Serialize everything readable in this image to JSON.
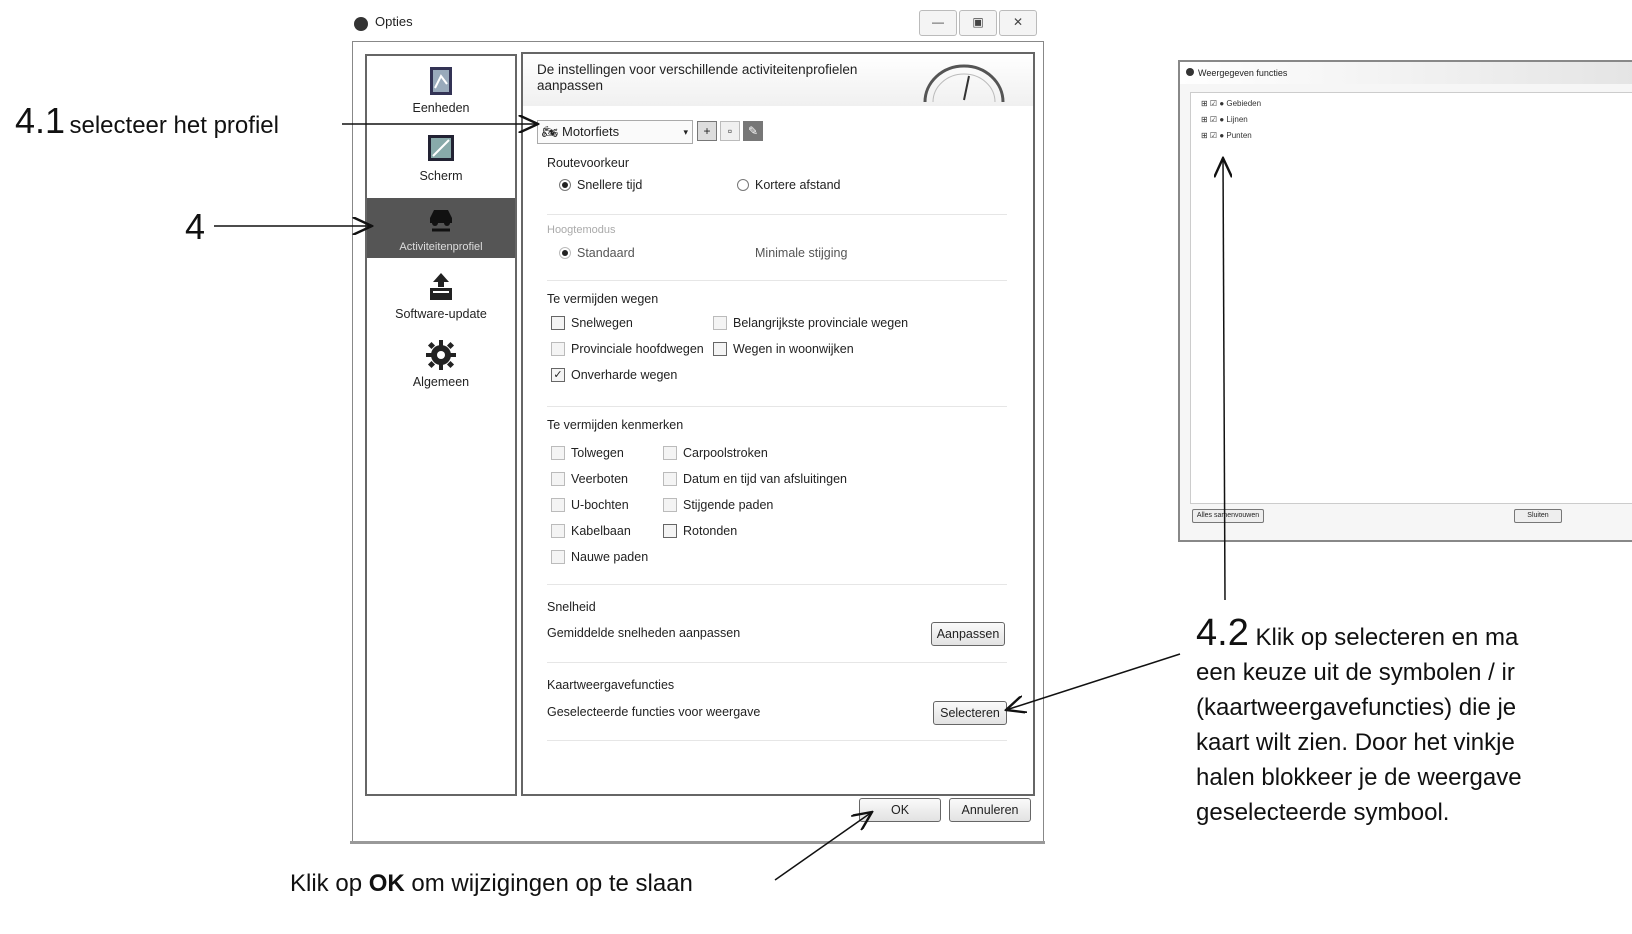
{
  "window": {
    "title": "Opties",
    "buttons": [
      "—",
      "▣",
      "✕"
    ]
  },
  "sidebar": {
    "items": [
      {
        "label": "Eenheden",
        "icon": "ruler-map-icon"
      },
      {
        "label": "Scherm",
        "icon": "screen-icon"
      },
      {
        "label": "Activiteitenprofiel",
        "icon": "car-wrench-icon",
        "active": true
      },
      {
        "label": "Software-update",
        "icon": "box-upload-icon"
      },
      {
        "label": "Algemeen",
        "icon": "gear-icon"
      }
    ]
  },
  "panel": {
    "header": "De instellingen voor verschillende activiteitenprofielen aanpassen",
    "profile_select": "Motorfiets",
    "route": {
      "title": "Routevoorkeur",
      "options": [
        "Snellere tijd",
        "Kortere afstand"
      ],
      "selected": "Snellere tijd"
    },
    "height": {
      "title": "Hoogtemodus",
      "options": [
        "Standaard",
        "Minimale stijging"
      ],
      "selected": "Standaard"
    },
    "avoid_roads": {
      "title": "Te vermijden wegen",
      "items": [
        {
          "label": "Snelwegen",
          "checked": false
        },
        {
          "label": "Belangrijkste provinciale wegen",
          "checked": false
        },
        {
          "label": "Provinciale hoofdwegen",
          "checked": false
        },
        {
          "label": "Wegen in woonwijken",
          "checked": false
        },
        {
          "label": "Onverharde wegen",
          "checked": true
        }
      ]
    },
    "avoid_features": {
      "title": "Te vermijden kenmerken",
      "items": [
        {
          "label": "Tolwegen",
          "checked": false
        },
        {
          "label": "Carpoolstroken",
          "checked": false
        },
        {
          "label": "Veerboten",
          "checked": false
        },
        {
          "label": "Datum en tijd van afsluitingen",
          "checked": false
        },
        {
          "label": "U-bochten",
          "checked": false
        },
        {
          "label": "Stijgende paden",
          "checked": false
        },
        {
          "label": "Kabelbaan",
          "checked": false
        },
        {
          "label": "Rotonden",
          "checked": false
        },
        {
          "label": "Nauwe paden",
          "checked": false
        }
      ]
    },
    "speed": {
      "title": "Snelheid",
      "label": "Gemiddelde snelheden aanpassen",
      "button": "Aanpassen"
    },
    "map_features": {
      "title": "Kaartweergavefuncties",
      "label": "Geselecteerde functies voor weergave",
      "button": "Selecteren"
    }
  },
  "footer": {
    "ok": "OK",
    "cancel": "Annuleren"
  },
  "side_window": {
    "title": "Weergegeven functies",
    "items": [
      "Gebieden",
      "Lijnen",
      "Punten"
    ],
    "left_button": "Alles samenvouwen",
    "right_button": "Sluiten"
  },
  "annotations": {
    "a41_num": "4.1",
    "a41_text": "selecteer het profiel",
    "a4": "4",
    "a42_num": "4.2",
    "a42_lines": [
      "Klik op selecteren en ma",
      "een keuze uit de symbolen / ir",
      "(kaartweergavefuncties) die je",
      "kaart wilt zien. Door het vinkje",
      "halen blokkeer je de weergave",
      "geselecteerde symbool."
    ],
    "ok_pre": "Klik op",
    "ok_bold": "OK",
    "ok_post": "om wijzigingen op te slaan"
  }
}
